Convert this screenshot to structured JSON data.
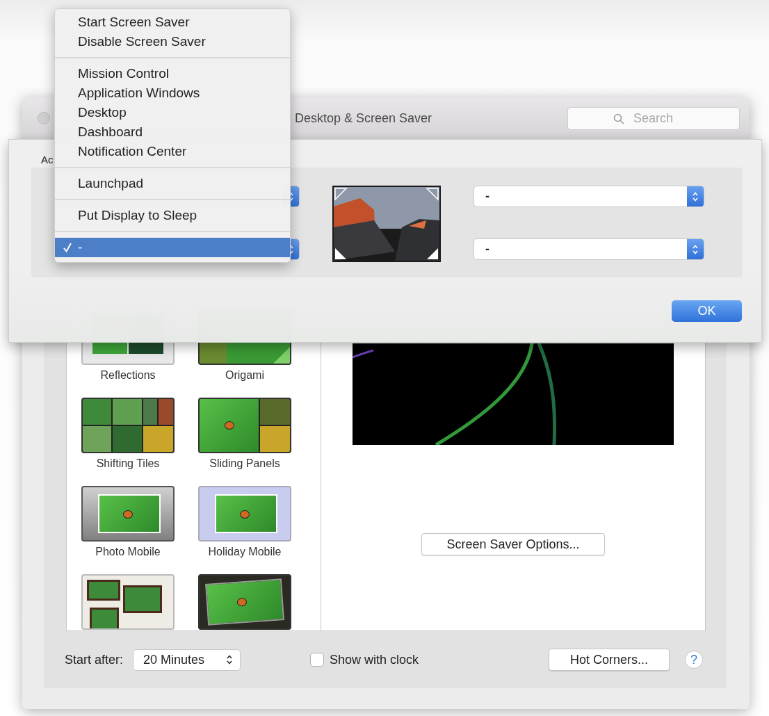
{
  "window": {
    "title": "Desktop & Screen Saver",
    "search": {
      "placeholder": "Search"
    }
  },
  "screen_savers": [
    {
      "kind": "reflections",
      "name": "Reflections"
    },
    {
      "kind": "origami",
      "name": "Origami"
    },
    {
      "kind": "tiles",
      "name": "Shifting Tiles"
    },
    {
      "kind": "panels",
      "name": "Sliding Panels"
    },
    {
      "kind": "mobile",
      "name": "Photo Mobile"
    },
    {
      "kind": "holiday",
      "name": "Holiday Mobile"
    },
    {
      "kind": "wall"
    },
    {
      "kind": "tilted"
    }
  ],
  "options_button": "Screen Saver Options...",
  "start_after": {
    "label": "Start after:",
    "value": "20 Minutes"
  },
  "show_with_clock": {
    "label": "Show with clock",
    "checked": false
  },
  "hot_corners_button": "Hot Corners...",
  "help_button": "?",
  "sheet": {
    "label": "Ac",
    "right_popups": [
      {
        "value": "-"
      },
      {
        "value": "-"
      }
    ],
    "ok_button": "OK"
  },
  "menu": {
    "groups": [
      [
        {
          "label": "Start Screen Saver",
          "checked": false,
          "selected": false
        },
        {
          "label": "Disable Screen Saver",
          "checked": false,
          "selected": false
        }
      ],
      [
        {
          "label": "Mission Control",
          "checked": false,
          "selected": false
        },
        {
          "label": "Application Windows",
          "checked": false,
          "selected": false
        },
        {
          "label": "Desktop",
          "checked": false,
          "selected": false
        },
        {
          "label": "Dashboard",
          "checked": false,
          "selected": false
        },
        {
          "label": "Notification Center",
          "checked": false,
          "selected": false
        }
      ],
      [
        {
          "label": "Launchpad",
          "checked": false,
          "selected": false
        }
      ],
      [
        {
          "label": "Put Display to Sleep",
          "checked": false,
          "selected": false
        }
      ],
      [
        {
          "label": "-",
          "checked": true,
          "selected": true
        }
      ]
    ]
  }
}
